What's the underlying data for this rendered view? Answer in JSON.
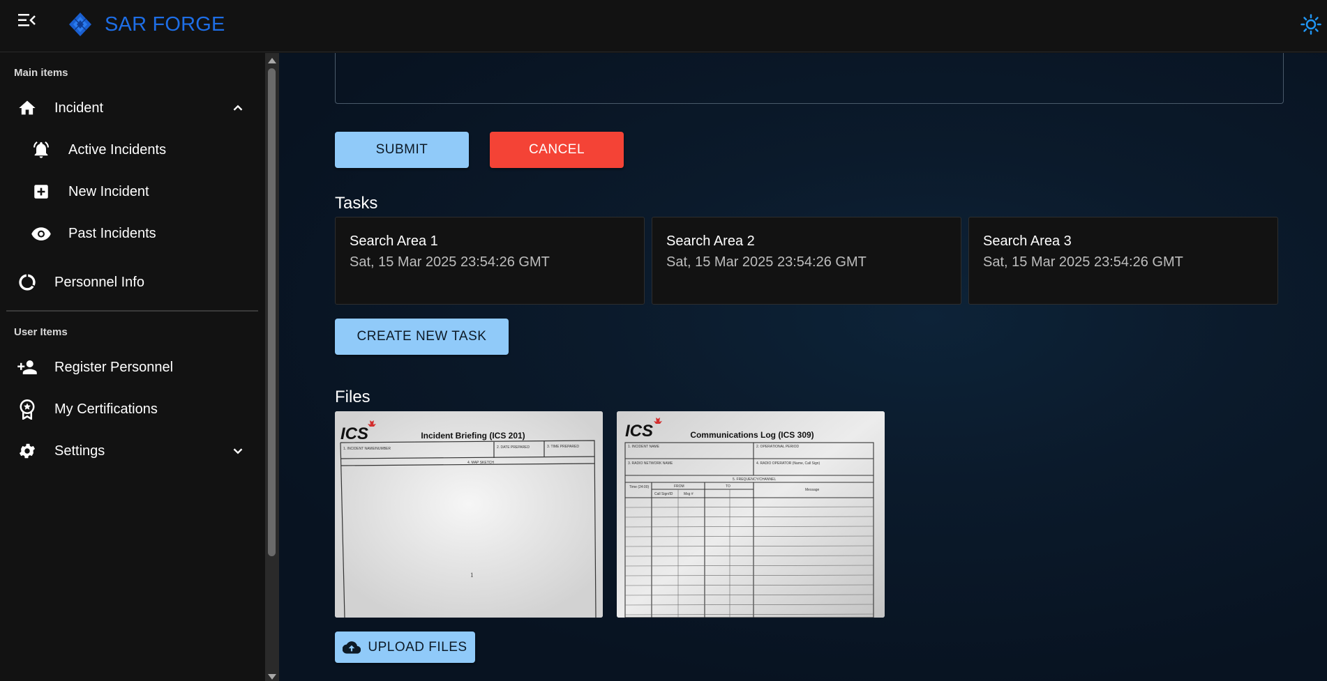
{
  "app": {
    "brand": "SAR FORGE",
    "colors": {
      "brand": "#1e6ee6",
      "primary_button": "#90caf9",
      "cancel_button": "#f44336",
      "theme_icon": "#2196f3"
    }
  },
  "sidebar": {
    "main_label": "Main items",
    "user_label": "User Items",
    "items": [
      {
        "label": "Incident",
        "icon": "home-icon",
        "expanded": true
      },
      {
        "label": "Active Incidents",
        "icon": "bell-ring-icon"
      },
      {
        "label": "New Incident",
        "icon": "add-box-icon"
      },
      {
        "label": "Past Incidents",
        "icon": "eye-icon"
      },
      {
        "label": "Personnel Info",
        "icon": "circle-notch-icon"
      },
      {
        "label": "Register Personnel",
        "icon": "person-add-icon"
      },
      {
        "label": "My Certifications",
        "icon": "badge-icon"
      },
      {
        "label": "Settings",
        "icon": "gear-icon",
        "expanded": false
      }
    ]
  },
  "form": {
    "submit_label": "SUBMIT",
    "cancel_label": "CANCEL"
  },
  "tasks": {
    "heading": "Tasks",
    "items": [
      {
        "title": "Search Area 1",
        "date": "Sat, 15 Mar 2025 23:54:26 GMT"
      },
      {
        "title": "Search Area 2",
        "date": "Sat, 15 Mar 2025 23:54:26 GMT"
      },
      {
        "title": "Search Area 3",
        "date": "Sat, 15 Mar 2025 23:54:26 GMT"
      }
    ],
    "create_label": "CREATE NEW TASK"
  },
  "files": {
    "heading": "Files",
    "items": [
      {
        "logo": "ICS",
        "title": "Incident Briefing (ICS 201)",
        "fields": [
          "1. INCIDENT NAME/NUMBER",
          "2. DATE PREPARED",
          "3. TIME PREPARED",
          "4. MAP SKETCH"
        ],
        "page": "1"
      },
      {
        "logo": "ICS",
        "title": "Communications Log (ICS 309)",
        "fields": [
          "1. INCIDENT NAME",
          "2. OPERATIONAL PERIOD",
          "3. RADIO NETWORK NAME",
          "4. RADIO OPERATOR (Name, Call Sign)",
          "5. FREQUENCY/CHANNEL",
          "Time (24:00)",
          "FROM",
          "TO",
          "Call Sign/ID",
          "Msg #",
          "Message"
        ]
      }
    ],
    "upload_label": "UPLOAD FILES"
  }
}
